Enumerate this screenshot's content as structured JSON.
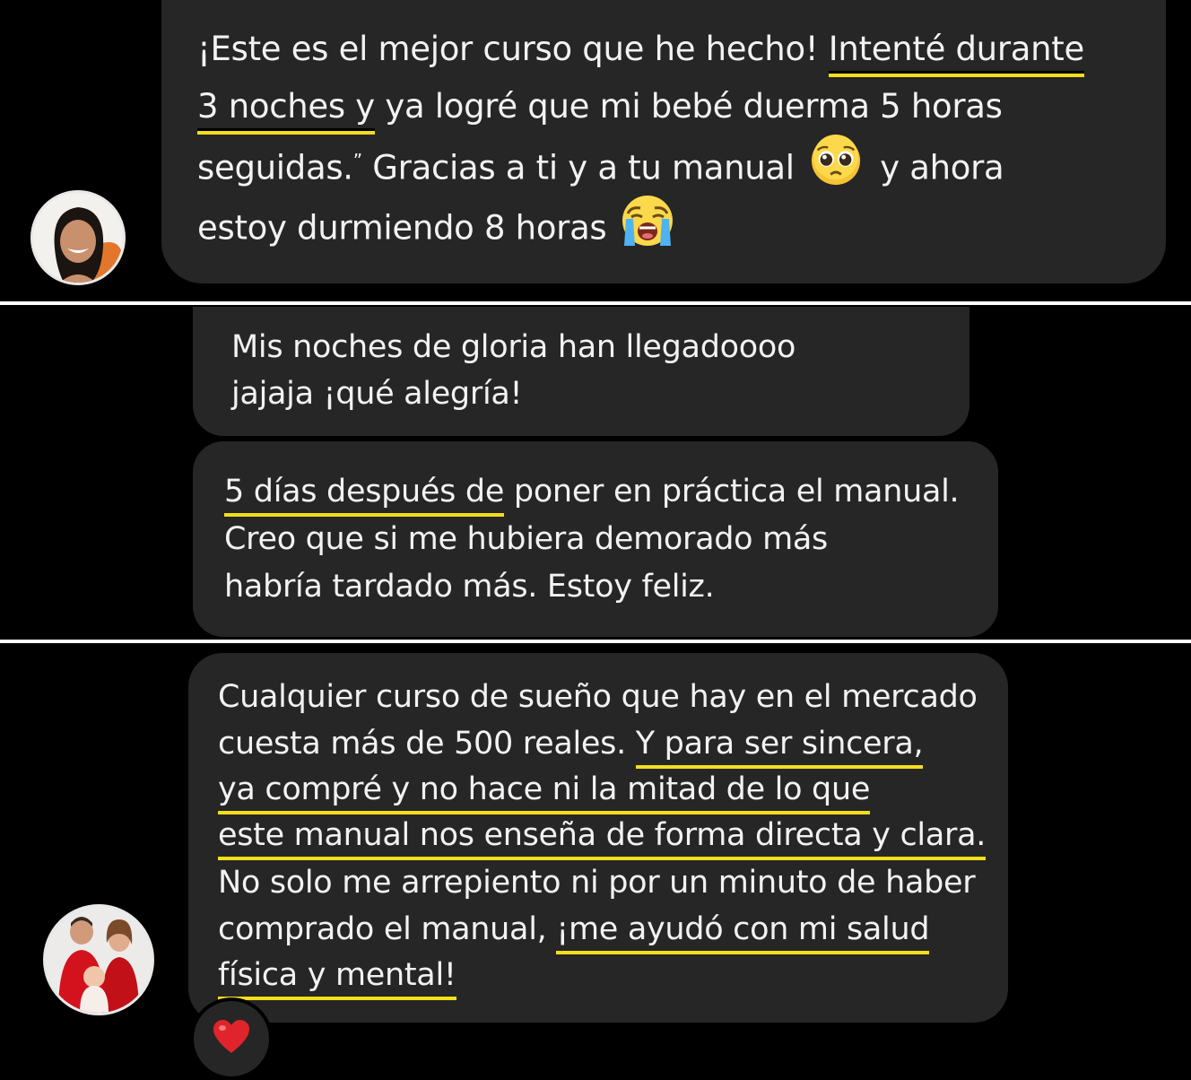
{
  "messages": [
    {
      "lines": [
        {
          "parts": [
            "¡Este es el mejor curso que he hecho! ",
            "Intenté durante"
          ]
        },
        {
          "parts": [
            "3 noches y",
            " ya logré que mi bebé duerma 5 horas"
          ]
        },
        {
          "parts": [
            "seguidas.",
            "”",
            " Gracias a ti y a tu manual ",
            "y ahora"
          ]
        },
        {
          "parts": [
            "estoy durmiendo 8 horas"
          ]
        }
      ],
      "emojis": [
        "pleading-face",
        "loudly-crying-face"
      ]
    },
    {
      "lines": [
        "Mis noches de gloria han llegadoooo",
        "jajaja ¡qué alegría!"
      ]
    },
    {
      "lines": [
        {
          "parts": [
            "5 días después de",
            " poner en práctica el manual."
          ]
        },
        "Creo que si me hubiera demorado más",
        "habría tardado más. Estoy feliz."
      ]
    },
    {
      "lines": [
        "Cualquier curso de sueño que hay en el mercado",
        {
          "parts": [
            "cuesta más de 500 reales. ",
            "Y para ser sincera,"
          ]
        },
        "ya compré y no hace ni la mitad de lo que",
        "este manual nos enseña de forma directa y clara.",
        "No solo me arrepiento ni por un minuto de haber",
        {
          "parts": [
            "comprado el manual, ",
            "¡me ayudó con mi salud"
          ]
        },
        "física y mental!"
      ],
      "reaction": "red-heart"
    }
  ],
  "colors": {
    "background": "#000000",
    "bubble": "#262626",
    "text": "#f2f2f2",
    "highlight_underline": "#f2de1d",
    "divider": "#ffffff",
    "heart": "#e0242b"
  }
}
